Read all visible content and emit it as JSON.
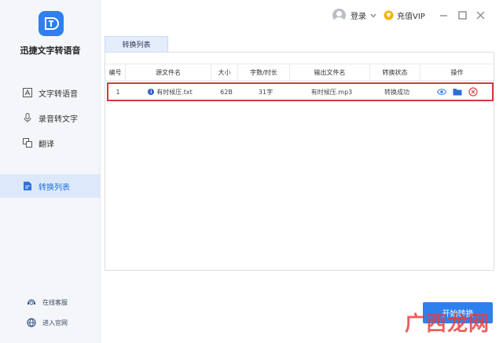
{
  "app": {
    "name": "迅捷文字转语音"
  },
  "sidebar": {
    "items": [
      {
        "label": "文字转语音",
        "icon": "text-to-speech-icon"
      },
      {
        "label": "录音转文字",
        "icon": "microphone-icon"
      },
      {
        "label": "翻译",
        "icon": "translate-icon"
      },
      {
        "label": "转换列表",
        "icon": "convert-list-icon",
        "active": true
      }
    ],
    "footer": [
      {
        "label": "在线客服",
        "icon": "customer-service-icon"
      },
      {
        "label": "进入官网",
        "icon": "globe-icon"
      }
    ]
  },
  "header": {
    "login_label": "登录",
    "vip_label": "充值VIP"
  },
  "tabs": [
    {
      "label": "转换列表"
    }
  ],
  "table": {
    "columns": [
      "编号",
      "源文件名",
      "大小",
      "字数/时长",
      "输出文件名",
      "转换状态",
      "操作"
    ],
    "rows": [
      {
        "id": "1",
        "source": "有时候压.txt",
        "size": "62B",
        "length": "31字",
        "output": "有时候压.mp3",
        "status": "转换成功"
      }
    ]
  },
  "actions": {
    "start_label": "开始转换"
  },
  "watermark": {
    "text": "广西龙网"
  },
  "colors": {
    "accent": "#2f80ef",
    "highlight_border": "#d23b3b",
    "active_nav_bg": "#dde9fb"
  }
}
